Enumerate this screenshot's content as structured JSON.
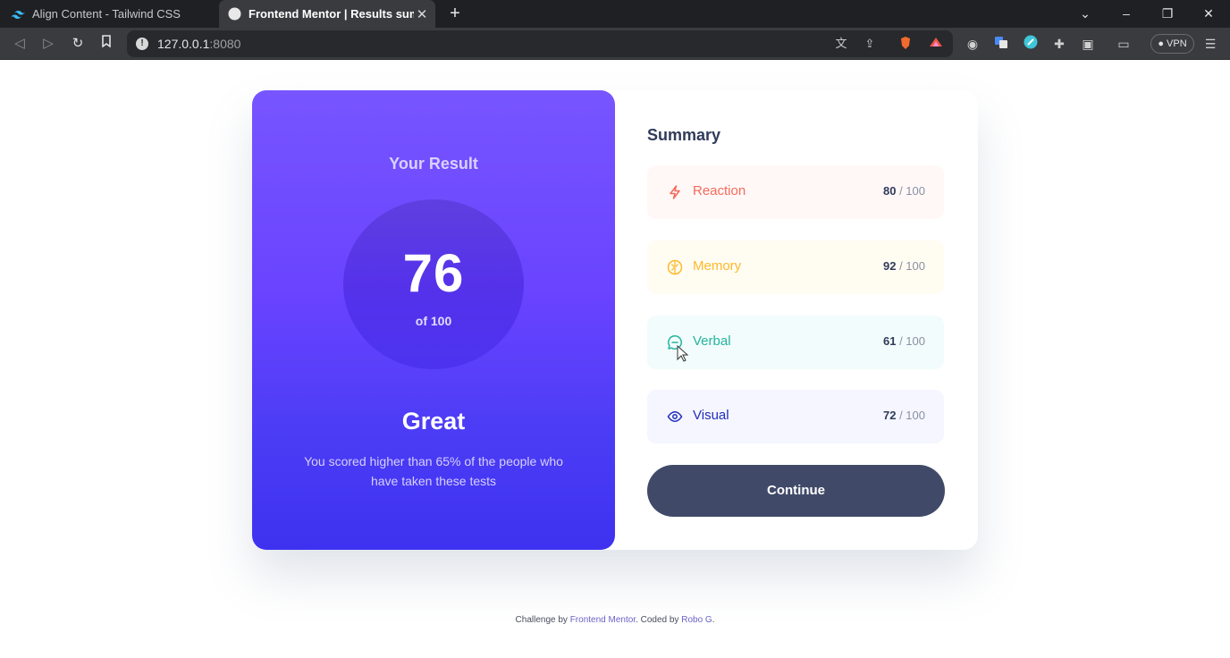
{
  "browser": {
    "tabs": [
      {
        "title": "Align Content - Tailwind CSS",
        "active": false
      },
      {
        "title": "Frontend Mentor | Results summ",
        "active": true
      }
    ],
    "new_tab": "+",
    "url_host": "127.0.0.1",
    "url_port": ":8080",
    "vpn_label": "VPN",
    "window_controls": {
      "minimize": "–",
      "restore": "❐",
      "close": "✕"
    }
  },
  "result": {
    "title": "Your Result",
    "score": "76",
    "score_of": "of 100",
    "rating": "Great",
    "description": "You scored higher than 65% of the people who have taken these tests"
  },
  "summary": {
    "title": "Summary",
    "categories": [
      {
        "label": "Reaction",
        "score": "80",
        "max": "/ 100",
        "icon": "lightning-icon",
        "color": "#f56a5a",
        "bg": "#fff8f7"
      },
      {
        "label": "Memory",
        "score": "92",
        "max": "/ 100",
        "icon": "brain-icon",
        "color": "#ffb92a",
        "bg": "#fffcf2"
      },
      {
        "label": "Verbal",
        "score": "61",
        "max": "/ 100",
        "icon": "chat-icon",
        "color": "#23b59e",
        "bg": "#f2fcfc"
      },
      {
        "label": "Visual",
        "score": "72",
        "max": "/ 100",
        "icon": "eye-icon",
        "color": "#1f2ebd",
        "bg": "#f5f6ff"
      }
    ],
    "continue_label": "Continue"
  },
  "attribution": {
    "prefix": "Challenge by",
    "link1": "Frontend Mentor",
    "middle": ". Coded by",
    "link2": "Robo G",
    "suffix": "."
  }
}
